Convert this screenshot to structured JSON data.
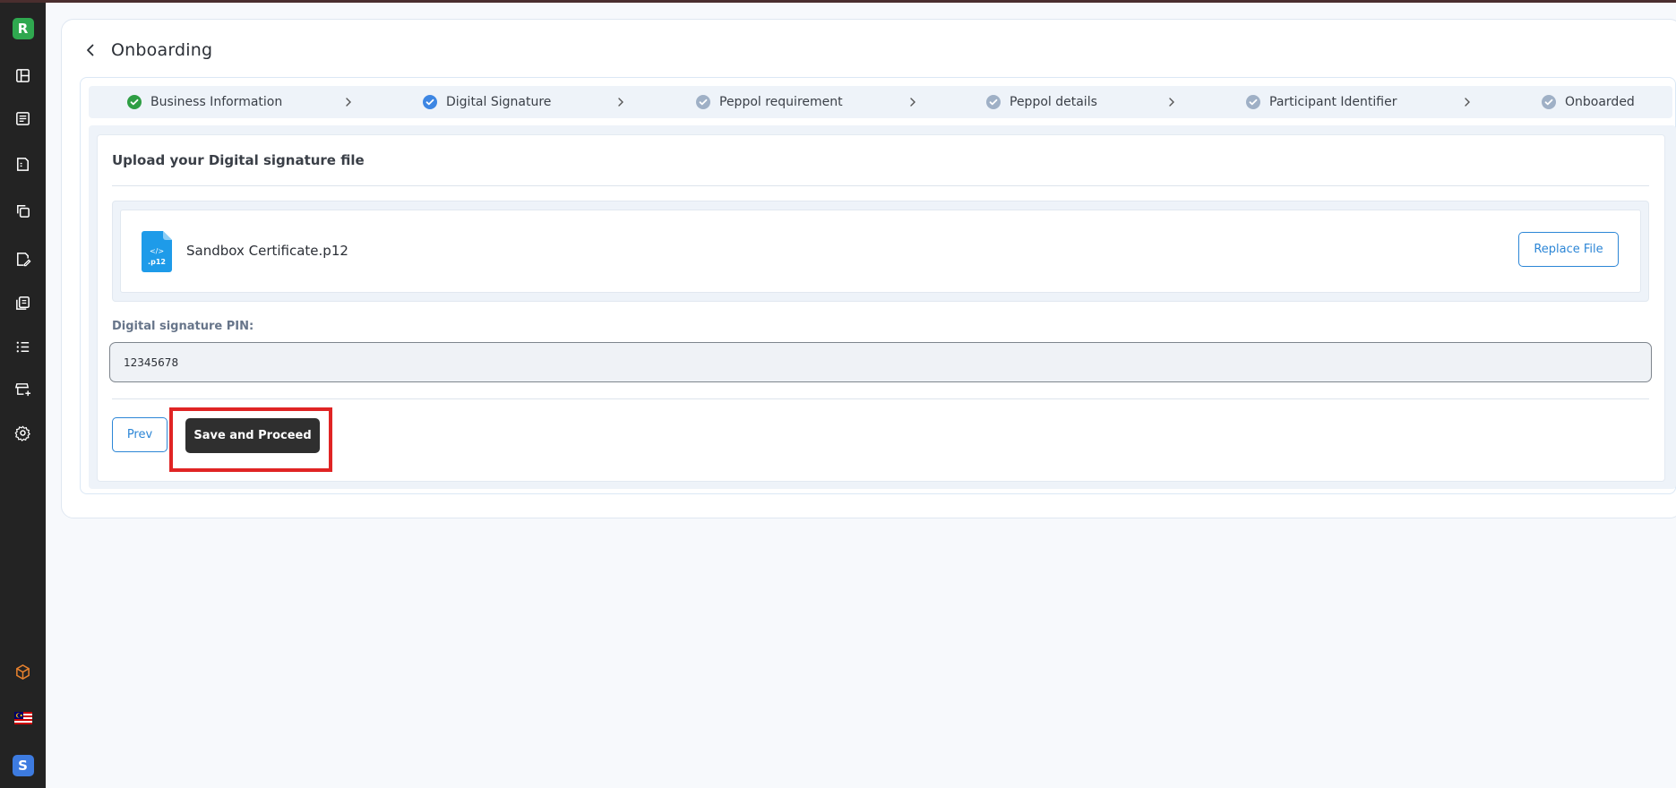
{
  "sidebar": {
    "logo_letter": "R",
    "bottom_logo_letter": "S",
    "icons": [
      "dashboard-icon",
      "invoice-list-icon",
      "receipt-icon",
      "copy-documents-icon",
      "edit-document-icon",
      "reports-icon",
      "list-icon",
      "store-add-icon",
      "settings-icon",
      "package-icon",
      "malaysia-flag-icon"
    ]
  },
  "header": {
    "title": "Onboarding"
  },
  "stepper": {
    "steps": [
      {
        "label": "Business Information",
        "status": "completed"
      },
      {
        "label": "Digital Signature",
        "status": "current"
      },
      {
        "label": "Peppol requirement",
        "status": "pending"
      },
      {
        "label": "Peppol details",
        "status": "pending"
      },
      {
        "label": "Participant Identifier",
        "status": "pending"
      },
      {
        "label": "Onboarded",
        "status": "pending"
      }
    ]
  },
  "form": {
    "section_title": "Upload your Digital signature file",
    "file_name": "Sandbox Certificate.p12",
    "file_badge_code": "</>",
    "file_badge_ext": ".p12",
    "replace_label": "Replace File",
    "pin_label": "Digital signature PIN:",
    "pin_value": "12345678",
    "prev_label": "Prev",
    "save_label": "Save and Proceed"
  },
  "colors": {
    "sidebar_bg": "#232323",
    "accent_blue": "#2c86d6",
    "completed_green": "#2e9e44",
    "current_blue": "#3d86e3",
    "pending_gray": "#9fb0c6",
    "highlight_red": "#e02424",
    "primary_button": "#2f2f2f"
  }
}
